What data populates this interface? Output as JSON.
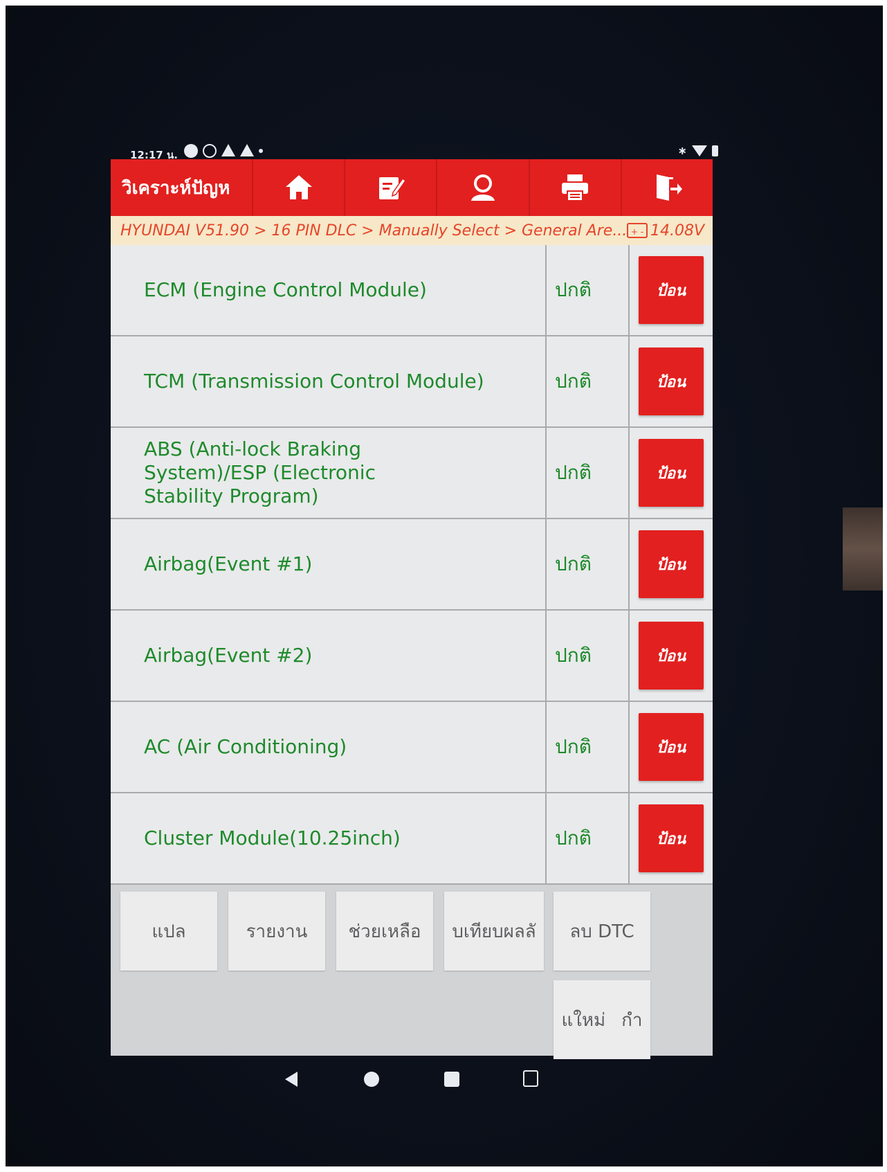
{
  "statusbar": {
    "time": "12:17 น."
  },
  "header": {
    "title": "วิเคราะห์ปัญห"
  },
  "toolbar": {
    "icons": [
      "home-icon",
      "edit-icon",
      "user-icon",
      "printer-icon",
      "exit-icon"
    ]
  },
  "breadcrumb": {
    "path": "HYUNDAI V51.90 > 16 PIN DLC > Manually Select > General Are...",
    "voltage": "14.08V",
    "battery_label": "+ -"
  },
  "modules": [
    {
      "name": "ECM (Engine Control Module)",
      "status": "ปกติ",
      "action": "ป้อน"
    },
    {
      "name": "TCM (Transmission Control Module)",
      "status": "ปกติ",
      "action": "ป้อน"
    },
    {
      "name": "ABS (Anti-lock Braking System)/ESP (Electronic Stability Program)",
      "status": "ปกติ",
      "action": "ป้อน"
    },
    {
      "name": "Airbag(Event #1)",
      "status": "ปกติ",
      "action": "ป้อน"
    },
    {
      "name": "Airbag(Event #2)",
      "status": "ปกติ",
      "action": "ป้อน"
    },
    {
      "name": "AC (Air Conditioning)",
      "status": "ปกติ",
      "action": "ป้อน"
    },
    {
      "name": "Cluster Module(10.25inch)",
      "status": "ปกติ",
      "action": "ป้อน"
    }
  ],
  "bottom_buttons": {
    "translate": "แปล",
    "report": "รายงาน",
    "help": "ช่วยเหลือ",
    "compare": "บเทียบผลลั",
    "clear_dtc": "ลบ DTC",
    "new": "แใหม่",
    "new_suffix": "กำ"
  },
  "colors": {
    "accent": "#e2201f",
    "module_text": "#1e8a2c",
    "breadcrumb_text": "#e6452b"
  }
}
